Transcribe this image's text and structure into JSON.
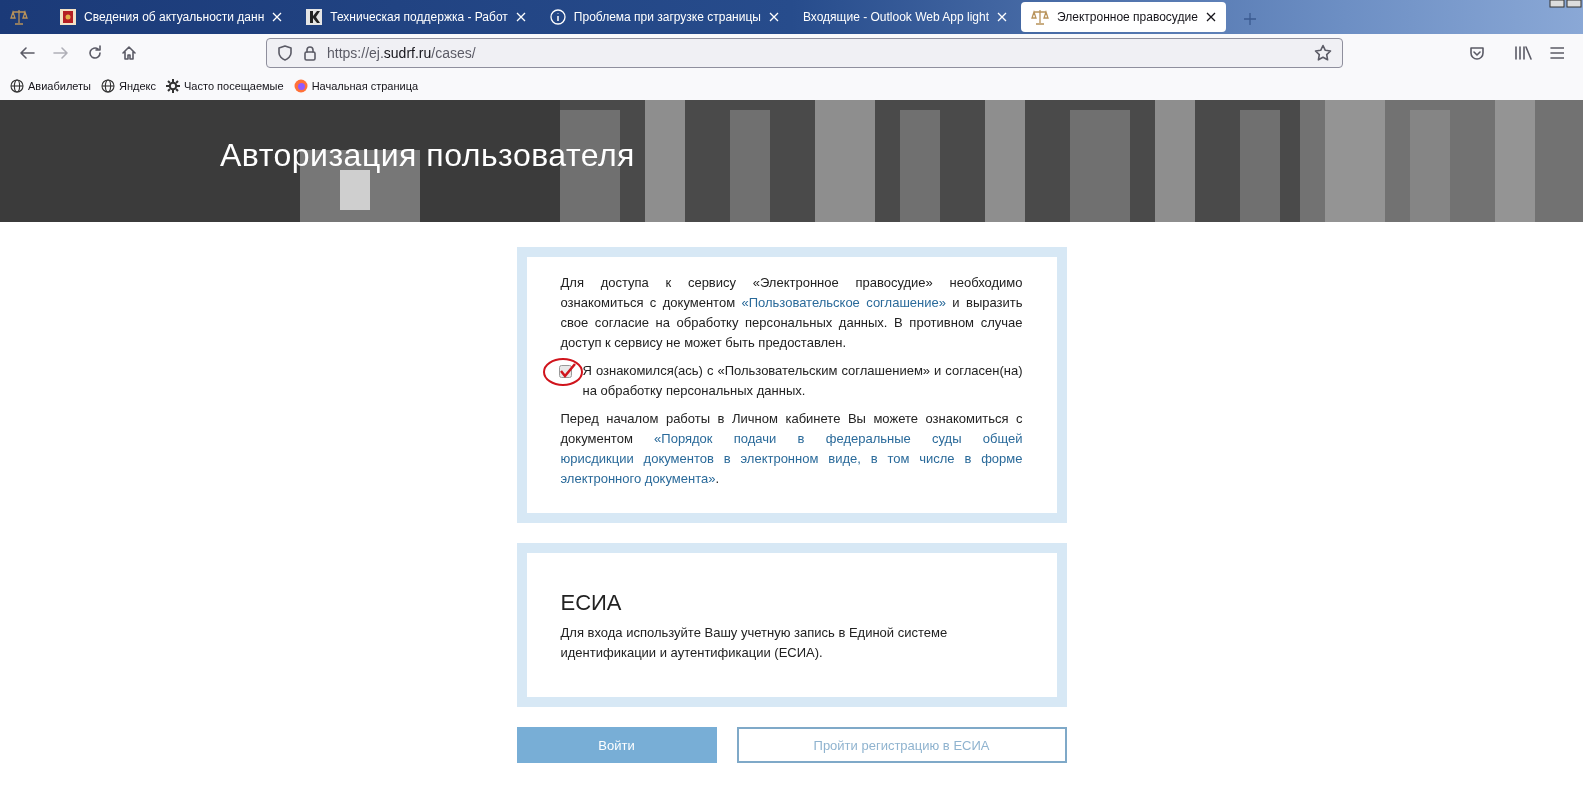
{
  "browser": {
    "tabs": [
      {
        "kind": "pinned",
        "selected": false
      },
      {
        "title": "Сведения об актуальности данн",
        "kind": "crest",
        "selected": false
      },
      {
        "title": "Техническая поддержка - Работ",
        "kind": "letter",
        "selected": false
      },
      {
        "title": "Проблема при загрузке страницы",
        "kind": "info",
        "selected": false
      },
      {
        "title": "Входящие - Outlook Web App light",
        "kind": "none",
        "selected": false
      },
      {
        "title": "Электронное правосудие",
        "kind": "scales",
        "selected": true
      }
    ],
    "url": {
      "prefix": "https://ej.",
      "host": "sudrf.ru",
      "path": "/cases/"
    },
    "bookmarks": [
      {
        "label": "Авиабилеты",
        "kind": "globe"
      },
      {
        "label": "Яндекс",
        "kind": "globe"
      },
      {
        "label": "Часто посещаемые",
        "kind": "gear"
      },
      {
        "label": "Начальная страница",
        "kind": "firefox"
      }
    ]
  },
  "hero": {
    "title": "Авторизация пользователя"
  },
  "agreement": {
    "paragraphs": [
      {
        "kind": "text",
        "segments": [
          {
            "kind": "text",
            "text": "Для доступа к сервису «Электронное правосудие» необходимо ознакомиться с документом "
          },
          {
            "kind": "link",
            "text": "«Пользовательское соглашение»"
          },
          {
            "kind": "text",
            "text": "  и выразить свое согласие на обработку персональных данных. В противном случае доступ к сервису не может быть предоставлен."
          }
        ]
      },
      {
        "kind": "consent",
        "checked": true,
        "text": "Я ознакомился(ась) с «Пользовательским соглашением» и согласен(на) на обработку персональных данных."
      },
      {
        "kind": "text",
        "segments": [
          {
            "kind": "text",
            "text": "Перед началом работы в Личном кабинете Вы можете ознакомиться с документом "
          },
          {
            "kind": "link",
            "text": "«Порядок подачи в федеральные суды общей"
          },
          {
            "kind": "link",
            "text": "юрисдикции документов в электронном виде, в том числе в форме"
          },
          {
            "kind": "link",
            "text": "электронного документа»"
          },
          {
            "kind": "text",
            "text": "."
          }
        ]
      }
    ]
  },
  "esia": {
    "title": "ЕСИА",
    "text": "Для входа используйте Вашу учетную запись в Единой системе идентификации и аутентификации (ЕСИА)."
  },
  "buttons": [
    {
      "label": "Войти",
      "kind": "primary"
    },
    {
      "label": "Пройти регистрацию в ЕСИА",
      "kind": "outline"
    }
  ]
}
